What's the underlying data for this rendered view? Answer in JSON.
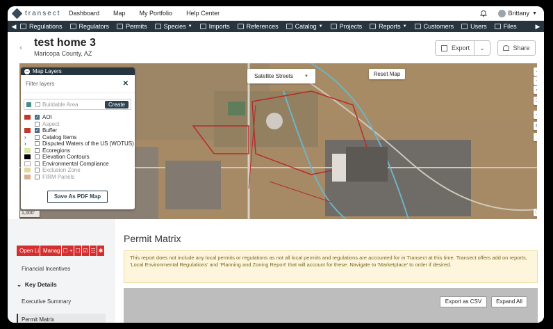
{
  "app": {
    "logo_text": "transect"
  },
  "topnav": [
    "Dashboard",
    "Map",
    "My Portfolio",
    "Help Center"
  ],
  "user": {
    "name": "Brittany"
  },
  "navbar": {
    "items": [
      {
        "label": "Regulations",
        "icon": "regulations-icon",
        "dropdown": false
      },
      {
        "label": "Regulators",
        "icon": "regulators-icon",
        "dropdown": false
      },
      {
        "label": "Permits",
        "icon": "permits-icon",
        "dropdown": false
      },
      {
        "label": "Species",
        "icon": "species-icon",
        "dropdown": true
      },
      {
        "label": "Imports",
        "icon": "imports-icon",
        "dropdown": false
      },
      {
        "label": "References",
        "icon": "references-icon",
        "dropdown": false
      },
      {
        "label": "Catalog",
        "icon": "catalog-icon",
        "dropdown": true
      },
      {
        "label": "Projects",
        "icon": "projects-icon",
        "dropdown": false
      },
      {
        "label": "Reports",
        "icon": "reports-icon",
        "dropdown": true
      },
      {
        "label": "Customers",
        "icon": "customers-icon",
        "dropdown": false
      },
      {
        "label": "Users",
        "icon": "users-icon",
        "dropdown": false
      },
      {
        "label": "Files",
        "icon": "files-icon",
        "dropdown": false
      }
    ]
  },
  "page": {
    "title": "test home 3",
    "subtitle": "Maricopa County, AZ",
    "export_label": "Export",
    "share_label": "Share"
  },
  "map": {
    "panel_title": "Map Layers",
    "filter_placeholder": "Filter layers",
    "buildable_label": "Buildable Area",
    "create_label": "Create",
    "layers": [
      {
        "label": "AOI",
        "checked": true,
        "dim": false,
        "legend_color": "#c0392b",
        "expandable": false
      },
      {
        "label": "Aspect",
        "checked": false,
        "dim": true,
        "legend_color": "",
        "expandable": false
      },
      {
        "label": "Buffer",
        "checked": true,
        "dim": false,
        "legend_color": "#c0392b",
        "expandable": false
      },
      {
        "label": "Catalog Items",
        "checked": false,
        "dim": false,
        "legend_color": "",
        "expandable": true
      },
      {
        "label": "Disputed Waters of the US (WOTUS)",
        "checked": false,
        "dim": false,
        "legend_color": "",
        "expandable": true
      },
      {
        "label": "Ecoregions",
        "checked": false,
        "dim": false,
        "legend_color": "#d9e7a8",
        "expandable": false
      },
      {
        "label": "Elevation Contours",
        "checked": false,
        "dim": false,
        "legend_color": "#000000",
        "expandable": false
      },
      {
        "label": "Environmental Compliance",
        "checked": false,
        "dim": false,
        "legend_color": "#ffffff",
        "expandable": false
      },
      {
        "label": "Exclusion Zone",
        "checked": false,
        "dim": true,
        "legend_color": "#e8d8a0",
        "expandable": false
      },
      {
        "label": "FIRM Panels",
        "checked": false,
        "dim": true,
        "legend_color": "#d8b090",
        "expandable": false
      }
    ],
    "save_pdf_label": "Save As PDF Map",
    "scale_label": "1,000'",
    "basemap_label": "Satellite Streets",
    "reset_label": "Reset Map"
  },
  "sidebar": {
    "action_buttons": [
      "Open Li",
      "Manag",
      "☐ +",
      "☐",
      "☑",
      "☲",
      "✱"
    ],
    "financial_label": "Financial Incentives",
    "key_details_label": "Key Details",
    "exec_summary_label": "Executive Summary",
    "permit_matrix_label": "Permit Matrix"
  },
  "content": {
    "title": "Permit Matrix",
    "notice": "This report does not include any local permits or regulations as not all local permits and regulations are accounted for in Transect at this time. Transect offers add on reports, 'Local Environmental Regulations' and 'Planning and Zoning Report' that will account for these. Navigate to 'Marketplace' to order if desired.",
    "export_csv_label": "Export as CSV",
    "expand_all_label": "Expand All"
  }
}
